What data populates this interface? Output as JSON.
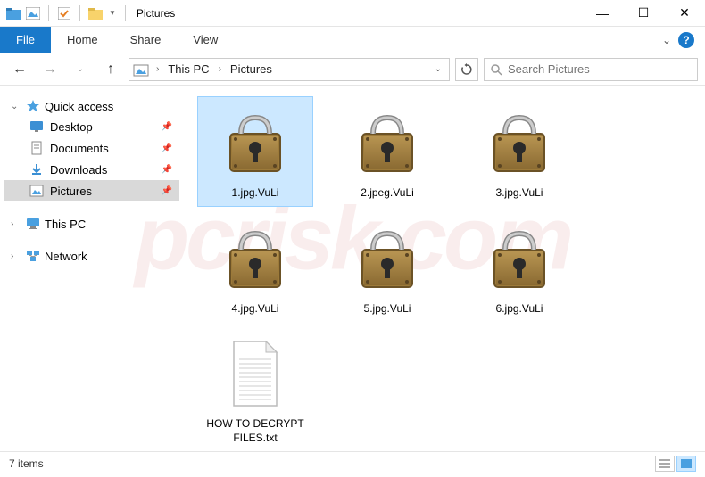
{
  "window": {
    "title": "Pictures",
    "controls": {
      "minimize": "—",
      "maximize": "☐",
      "close": "✕"
    }
  },
  "ribbon": {
    "file": "File",
    "tabs": [
      "Home",
      "Share",
      "View"
    ]
  },
  "nav": {
    "crumbs": [
      "This PC",
      "Pictures"
    ],
    "search_placeholder": "Search Pictures"
  },
  "sidebar": {
    "quick_access": {
      "label": "Quick access",
      "items": [
        {
          "label": "Desktop",
          "icon": "desktop",
          "pinned": true
        },
        {
          "label": "Documents",
          "icon": "documents",
          "pinned": true
        },
        {
          "label": "Downloads",
          "icon": "downloads",
          "pinned": true
        },
        {
          "label": "Pictures",
          "icon": "pictures",
          "pinned": true,
          "selected": true
        }
      ]
    },
    "this_pc": {
      "label": "This PC"
    },
    "network": {
      "label": "Network"
    }
  },
  "files": [
    {
      "name": "1.jpg.VuLi",
      "type": "locked",
      "selected": true
    },
    {
      "name": "2.jpeg.VuLi",
      "type": "locked"
    },
    {
      "name": "3.jpg.VuLi",
      "type": "locked"
    },
    {
      "name": "4.jpg.VuLi",
      "type": "locked"
    },
    {
      "name": "5.jpg.VuLi",
      "type": "locked"
    },
    {
      "name": "6.jpg.VuLi",
      "type": "locked"
    },
    {
      "name": "HOW TO DECRYPT FILES.txt",
      "type": "text"
    }
  ],
  "status": {
    "count_label": "7 items"
  },
  "watermark": "pcrisk.com"
}
